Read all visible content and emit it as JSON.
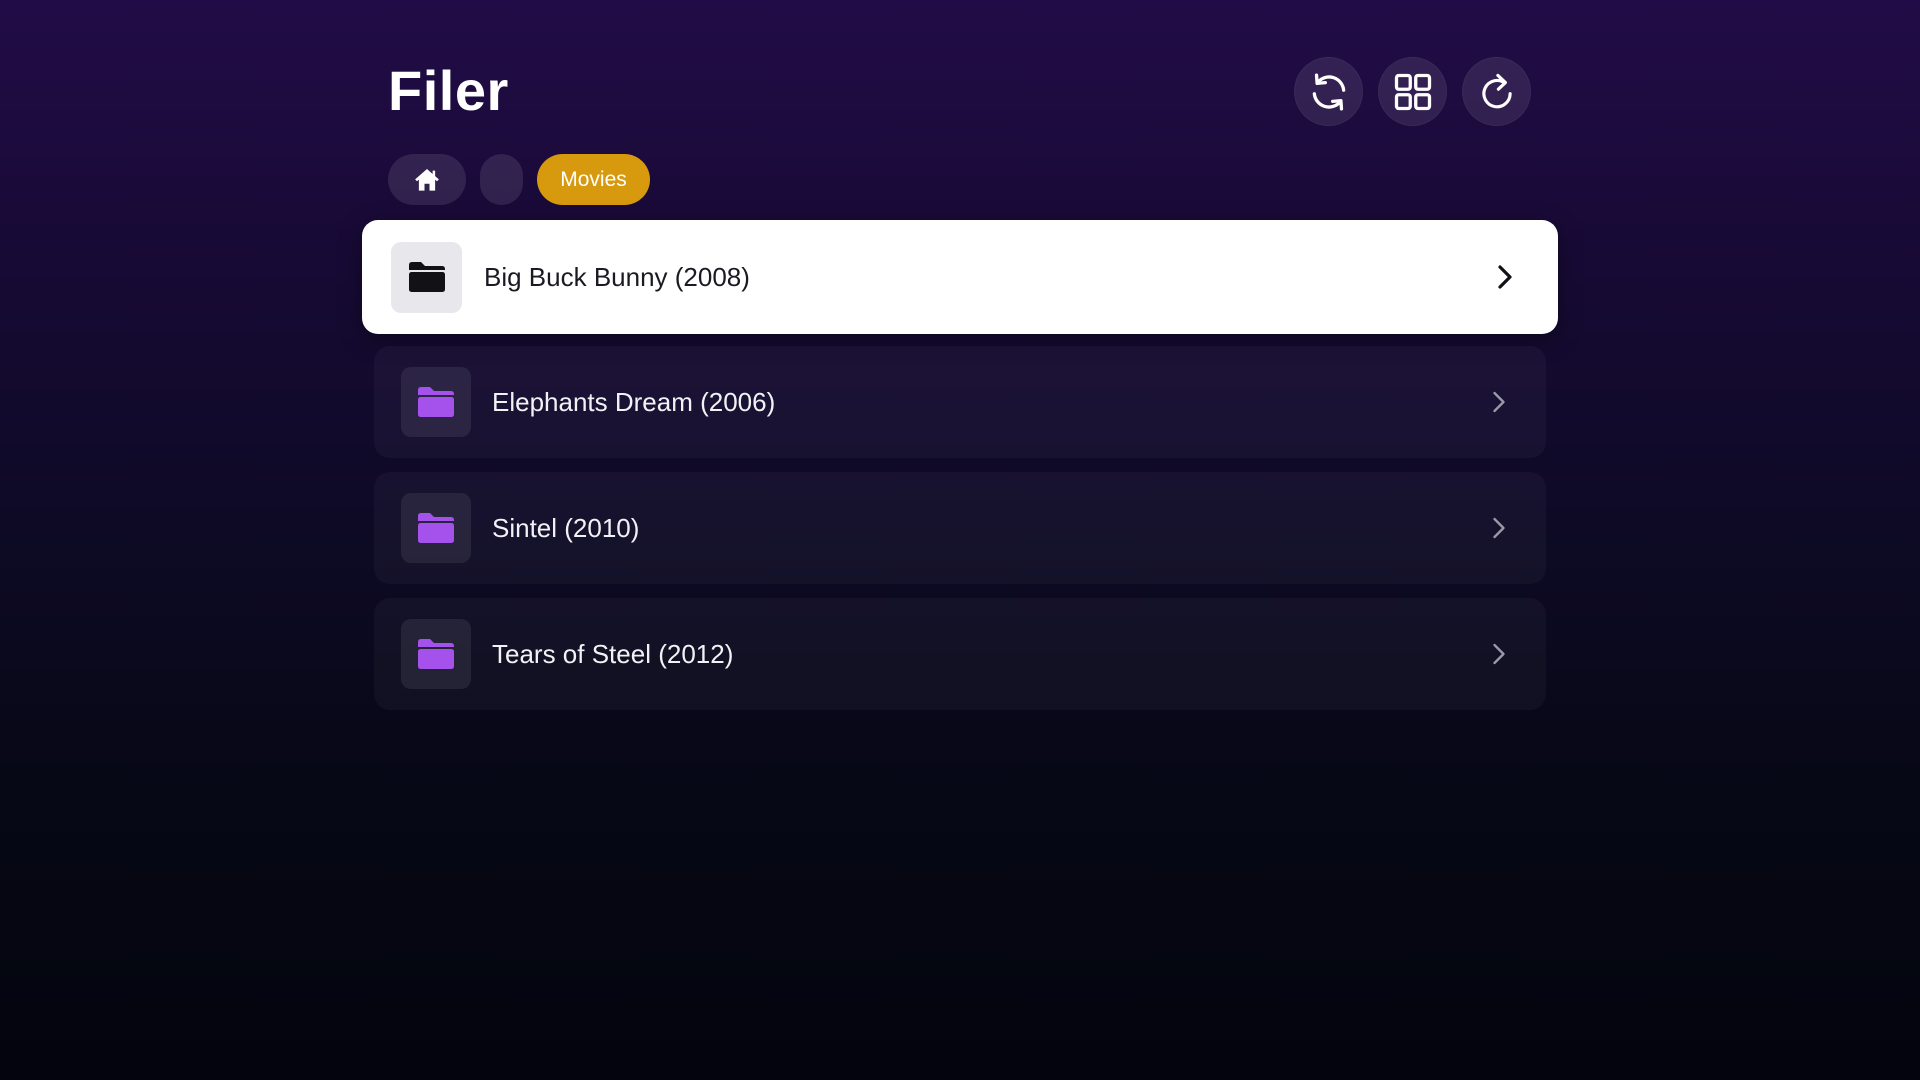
{
  "app": {
    "title": "Filer"
  },
  "toolbar": {
    "buttons": [
      {
        "icon": "sync-icon"
      },
      {
        "icon": "grid-view-icon"
      },
      {
        "icon": "refresh-icon"
      }
    ]
  },
  "breadcrumb": {
    "items": [
      {
        "icon": "home-icon",
        "label": ""
      },
      {
        "label": ""
      },
      {
        "label": "Movies"
      }
    ]
  },
  "files": [
    {
      "name": "Big Buck Bunny (2008)",
      "type": "folder",
      "focused": true
    },
    {
      "name": "Elephants Dream (2006)",
      "type": "folder",
      "focused": false
    },
    {
      "name": "Sintel (2010)",
      "type": "folder",
      "focused": false
    },
    {
      "name": "Tears of Steel (2012)",
      "type": "folder",
      "focused": false
    }
  ],
  "colors": {
    "accent": "#d79a0e",
    "folder": "#a551ec",
    "focused_background": "#ffffff",
    "background_top": "#220c47",
    "background_bottom": "#03040d"
  }
}
